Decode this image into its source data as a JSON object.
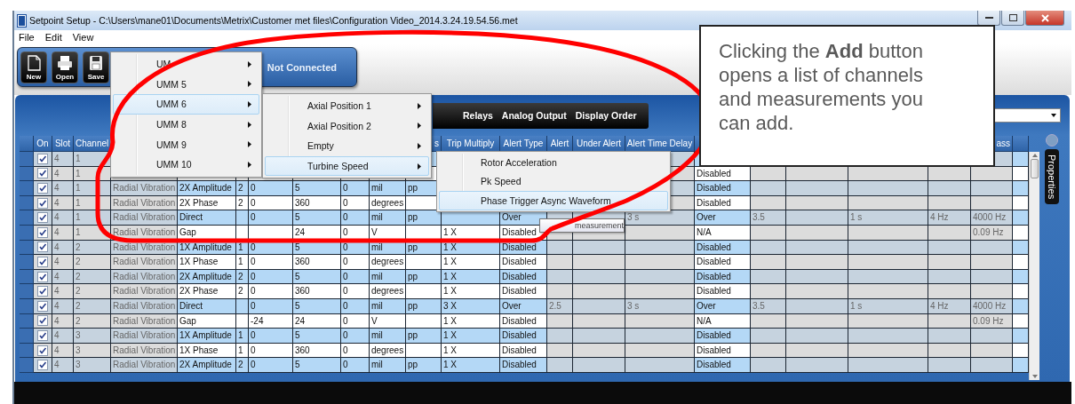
{
  "window": {
    "title": "Setpoint Setup - C:\\Users\\mane01\\Documents\\Metrix\\Customer met files\\Configuration Video_2014.3.24.19.54.56.met"
  },
  "menu_bar": [
    "File",
    "Edit",
    "View"
  ],
  "toolbar": {
    "buttons": [
      {
        "label": "New",
        "kind": "new"
      },
      {
        "label": "Open",
        "kind": "open"
      },
      {
        "label": "Save",
        "kind": "save"
      }
    ],
    "status": "Not Connected"
  },
  "tabs": [
    {
      "label": "Relays",
      "selected": false
    },
    {
      "label": "Analog Output",
      "selected": false
    },
    {
      "label": "Display Order",
      "selected": false
    }
  ],
  "grid": {
    "checkbox_header": "On",
    "columns": [
      {
        "label": "Slot",
        "editable": false
      },
      {
        "label": "Channel",
        "editable": false
      },
      {
        "editable": false
      },
      {
        "editable": true
      },
      {
        "editable": true
      },
      {
        "editable": true
      },
      {
        "editable": true
      },
      {
        "editable": true
      },
      {
        "editable": true
      },
      {
        "label": "s",
        "editable": true
      },
      {
        "label": "Trip Multiply",
        "editable": true
      },
      {
        "label": "Alert Type",
        "editable": true
      },
      {
        "label": "Alert",
        "editable": false
      },
      {
        "label": "Under Alert",
        "editable": false
      },
      {
        "label": "Alert Time Delay",
        "editable": false
      },
      {
        "editable": true
      },
      {
        "editable": false
      },
      {
        "editable": false
      },
      {
        "editable": false
      },
      {
        "editable": false
      },
      {
        "label": "ass",
        "editable": false
      },
      {
        "editable": true
      }
    ],
    "rows": [
      {
        "on": true,
        "cells": [
          "4",
          "1",
          "",
          "",
          "",
          "",
          "",
          "",
          "",
          "",
          "",
          "",
          "",
          "",
          "",
          "",
          "",
          "",
          "",
          "",
          "",
          ""
        ]
      },
      {
        "on": true,
        "cells": [
          "4",
          "1",
          "",
          "",
          "",
          "",
          "",
          "",
          "",
          "",
          "",
          "",
          "",
          "",
          "",
          "Disabled",
          "",
          "",
          "",
          "",
          "",
          ""
        ]
      },
      {
        "on": true,
        "cells": [
          "4",
          "1",
          "Radial Vibration",
          "2X Amplitude",
          "2",
          "0",
          "5",
          "0",
          "mil",
          "pp",
          "",
          "",
          "",
          "",
          "",
          "Disabled",
          "",
          "",
          "",
          "",
          "",
          ""
        ]
      },
      {
        "on": true,
        "cells": [
          "4",
          "1",
          "Radial Vibration",
          "2X Phase",
          "2",
          "0",
          "360",
          "0",
          "degrees",
          "",
          "",
          "",
          "",
          "",
          "",
          "Disabled",
          "",
          "",
          "",
          "",
          "",
          ""
        ]
      },
      {
        "on": true,
        "cells": [
          "4",
          "1",
          "Radial Vibration",
          "Direct",
          "",
          "0",
          "5",
          "0",
          "mil",
          "pp",
          "",
          "Over",
          "",
          "",
          "3 s",
          "Over",
          "3.5",
          "",
          "1 s",
          "4 Hz",
          "4000 Hz",
          ""
        ]
      },
      {
        "on": true,
        "cells": [
          "4",
          "1",
          "Radial Vibration",
          "Gap",
          "",
          "",
          "24",
          "0",
          "V",
          "",
          "1 X",
          "Disabled",
          "",
          "",
          "",
          "N/A",
          "",
          "",
          "",
          "",
          "0.09 Hz",
          ""
        ]
      },
      {
        "on": true,
        "cells": [
          "4",
          "2",
          "Radial Vibration",
          "1X Amplitude",
          "1",
          "0",
          "5",
          "0",
          "mil",
          "pp",
          "1 X",
          "Disabled",
          "",
          "",
          "",
          "Disabled",
          "",
          "",
          "",
          "",
          "",
          ""
        ]
      },
      {
        "on": true,
        "cells": [
          "4",
          "2",
          "Radial Vibration",
          "1X Phase",
          "1",
          "0",
          "360",
          "0",
          "degrees",
          "",
          "1 X",
          "Disabled",
          "",
          "",
          "",
          "Disabled",
          "",
          "",
          "",
          "",
          "",
          ""
        ]
      },
      {
        "on": true,
        "cells": [
          "4",
          "2",
          "Radial Vibration",
          "2X Amplitude",
          "2",
          "0",
          "5",
          "0",
          "mil",
          "pp",
          "1 X",
          "Disabled",
          "",
          "",
          "",
          "Disabled",
          "",
          "",
          "",
          "",
          "",
          ""
        ]
      },
      {
        "on": true,
        "cells": [
          "4",
          "2",
          "Radial Vibration",
          "2X Phase",
          "2",
          "0",
          "360",
          "0",
          "degrees",
          "",
          "1 X",
          "Disabled",
          "",
          "",
          "",
          "Disabled",
          "",
          "",
          "",
          "",
          "",
          ""
        ]
      },
      {
        "on": true,
        "cells": [
          "4",
          "2",
          "Radial Vibration",
          "Direct",
          "",
          "0",
          "5",
          "0",
          "mil",
          "pp",
          "3 X",
          "Over",
          "2.5",
          "",
          "3 s",
          "Over",
          "3.5",
          "",
          "1 s",
          "4 Hz",
          "4000 Hz",
          ""
        ]
      },
      {
        "on": true,
        "cells": [
          "4",
          "2",
          "Radial Vibration",
          "Gap",
          "",
          "-24",
          "24",
          "0",
          "V",
          "",
          "1 X",
          "Disabled",
          "",
          "",
          "",
          "N/A",
          "",
          "",
          "",
          "",
          "0.09 Hz",
          ""
        ]
      },
      {
        "on": true,
        "cells": [
          "4",
          "3",
          "Radial Vibration",
          "1X Amplitude",
          "1",
          "0",
          "5",
          "0",
          "mil",
          "pp",
          "1 X",
          "Disabled",
          "",
          "",
          "",
          "Disabled",
          "",
          "",
          "",
          "",
          "",
          ""
        ]
      },
      {
        "on": true,
        "cells": [
          "4",
          "3",
          "Radial Vibration",
          "1X Phase",
          "1",
          "0",
          "360",
          "0",
          "degrees",
          "",
          "1 X",
          "Disabled",
          "",
          "",
          "",
          "Disabled",
          "",
          "",
          "",
          "",
          "",
          ""
        ]
      },
      {
        "on": true,
        "cells": [
          "4",
          "3",
          "Radial Vibration",
          "2X Amplitude",
          "2",
          "0",
          "5",
          "0",
          "mil",
          "pp",
          "1 X",
          "Disabled",
          "",
          "",
          "",
          "Disabled",
          "",
          "",
          "",
          "",
          "",
          ""
        ]
      }
    ]
  },
  "side_panel": {
    "label": "Properties"
  },
  "menus": [
    {
      "items": [
        {
          "label": "UM",
          "selected": false,
          "submenu": true
        },
        {
          "label": "UMM 5",
          "selected": false,
          "submenu": true
        },
        {
          "label": "UMM 6",
          "selected": true,
          "submenu": true
        },
        {
          "label": "UMM 8",
          "selected": false,
          "submenu": true
        },
        {
          "label": "UMM 9",
          "selected": false,
          "submenu": true
        },
        {
          "label": "UMM 10",
          "selected": false,
          "submenu": true
        }
      ]
    },
    {
      "items": [
        {
          "label": "Axial Position 1",
          "selected": false,
          "submenu": true
        },
        {
          "label": "Axial Position 2",
          "selected": false,
          "submenu": true
        },
        {
          "label": "Empty",
          "selected": false,
          "submenu": true
        },
        {
          "label": "Turbine Speed",
          "selected": true,
          "submenu": true
        }
      ]
    },
    {
      "items": [
        {
          "label": "Rotor Acceleration",
          "selected": false,
          "submenu": false
        },
        {
          "label": "Pk Speed",
          "selected": false,
          "submenu": false
        },
        {
          "label": "Phase Trigger Async Waveform",
          "selected": true,
          "submenu": false
        }
      ]
    }
  ],
  "tooltip": "measurement",
  "callout": {
    "text": "Clicking the **Add** button opens a list of channels and measurements you can add."
  }
}
